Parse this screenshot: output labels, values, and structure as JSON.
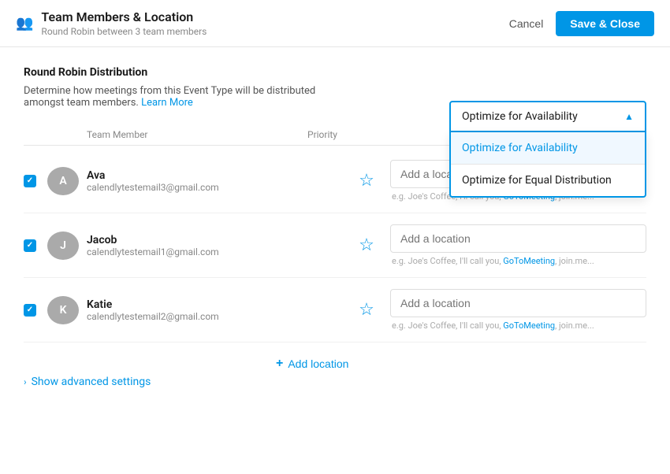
{
  "header": {
    "icon": "👤",
    "title": "Team Members & Location",
    "subtitle": "Round Robin between 3 team members",
    "cancel_label": "Cancel",
    "save_label": "Save & Close"
  },
  "section": {
    "title": "Round Robin Distribution",
    "description": "Determine how meetings from this Event Type will be distributed amongst team members.",
    "learn_more_label": "Learn More"
  },
  "dropdown": {
    "selected": "Optimize for Availability",
    "options": [
      {
        "label": "Optimize for Availability",
        "active": true
      },
      {
        "label": "Optimize for Equal Distribution",
        "active": false
      }
    ]
  },
  "table": {
    "col_member": "Team Member",
    "col_priority": "Priority",
    "members": [
      {
        "name": "Ava",
        "email": "calendlytestemail3@gmail.com",
        "avatar_letter": "A",
        "avatar_color": "#aaa",
        "checked": true,
        "location_placeholder": "Add a location",
        "hint": "e.g. Joe's Coffee, I'll call you, ",
        "hint_link": "GoToMeeting",
        "hint_suffix": ", join.me..."
      },
      {
        "name": "Jacob",
        "email": "calendlytestemail1@gmail.com",
        "avatar_letter": "J",
        "avatar_color": "#aaa",
        "checked": true,
        "location_placeholder": "Add a location",
        "hint": "e.g. Joe's Coffee, I'll call you, ",
        "hint_link": "GoToMeeting",
        "hint_suffix": ", join.me..."
      },
      {
        "name": "Katie",
        "email": "calendlytestemail2@gmail.com",
        "avatar_letter": "K",
        "avatar_color": "#aaa",
        "checked": true,
        "location_placeholder": "Add a location",
        "hint": "e.g. Joe's Coffee, I'll call you, ",
        "hint_link": "GoToMeeting",
        "hint_suffix": ", join.me..."
      }
    ]
  },
  "add_location_label": "Add location",
  "advanced_settings_label": "Show advanced settings"
}
